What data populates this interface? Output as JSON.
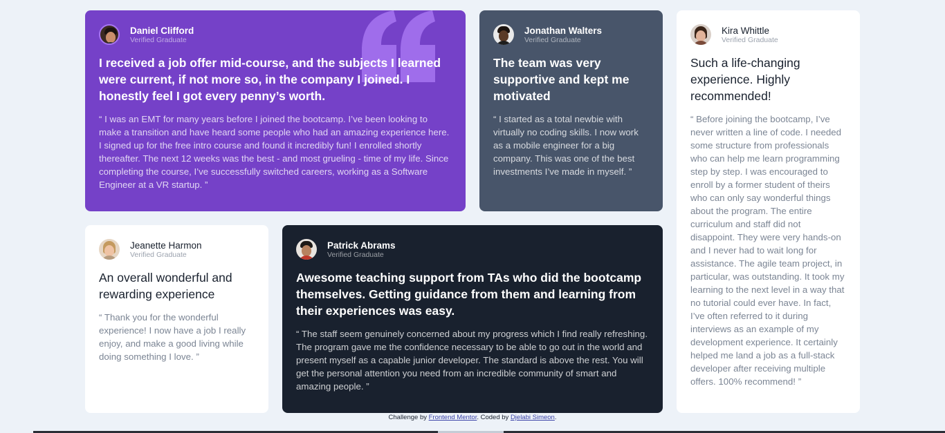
{
  "colors": {
    "background": "#edf2f8",
    "purple": "#7541c8",
    "slate": "#48556a",
    "dark": "#19212e",
    "white": "#ffffff"
  },
  "testimonials": [
    {
      "name": "Daniel Clifford",
      "role": "Verified Graduate",
      "headline": "I received a job offer mid-course, and the subjects I learned were current, if not more so, in the company I joined. I honestly feel I got every penny’s worth.",
      "quote": "“ I was an EMT for many years before I joined the bootcamp. I’ve been looking to make a transition and have heard some people who had an amazing experience here. I signed up for the free intro course and found it incredibly fun! I enrolled shortly thereafter. The next 12 weeks was the best - and most grueling - time of my life. Since completing the course, I’ve successfully switched careers, working as a Software Engineer at a VR startup. ”"
    },
    {
      "name": "Jonathan Walters",
      "role": "Verified Graduate",
      "headline": "The team was very supportive and kept me motivated",
      "quote": "“ I started as a total newbie with virtually no coding skills. I now work as a mobile engineer for a big company. This was one of the best investments I’ve made in myself. ”"
    },
    {
      "name": "Kira Whittle",
      "role": "Verified Graduate",
      "headline": "Such a life-changing experience. Highly recommended!",
      "quote": "“ Before joining the bootcamp, I’ve never written a line of code. I needed some structure from professionals who can help me learn programming step by step. I was encouraged to enroll by a former student of theirs who can only say wonderful things about the program. The entire curriculum and staff did not disappoint. They were very hands-on and I never had to wait long for assistance. The agile team project, in particular, was outstanding. It took my learning to the next level in a way that no tutorial could ever have. In fact, I’ve often referred to it during interviews as an example of my development experience. It certainly helped me land a job as a full-stack developer after receiving multiple offers. 100% recommend! ”"
    },
    {
      "name": "Jeanette Harmon",
      "role": "Verified Graduate",
      "headline": "An overall wonderful and rewarding experience",
      "quote": "“ Thank you for the wonderful experience! I now have a job I really enjoy, and make a good living while doing something I love. ”"
    },
    {
      "name": "Patrick Abrams",
      "role": "Verified Graduate",
      "headline": "Awesome teaching support from TAs who did the bootcamp themselves. Getting guidance from them and learning from their experiences was easy.",
      "quote": "“ The staff seem genuinely concerned about my progress which I find really refreshing. The program gave me the confidence necessary to be able to go out in the world and present myself as a capable junior developer. The standard is above the rest. You will get the personal attention you need from an incredible community of smart and amazing people. ”"
    }
  ],
  "footer": {
    "prefix": "Challenge by ",
    "challenge_link": "Frontend Mentor",
    "middle": ". Coded by ",
    "author_link": "Djelabi Simeon",
    "suffix": "."
  },
  "icons": {
    "quote_mark": "quotation-mark-icon",
    "avatar": "avatar-photo"
  }
}
